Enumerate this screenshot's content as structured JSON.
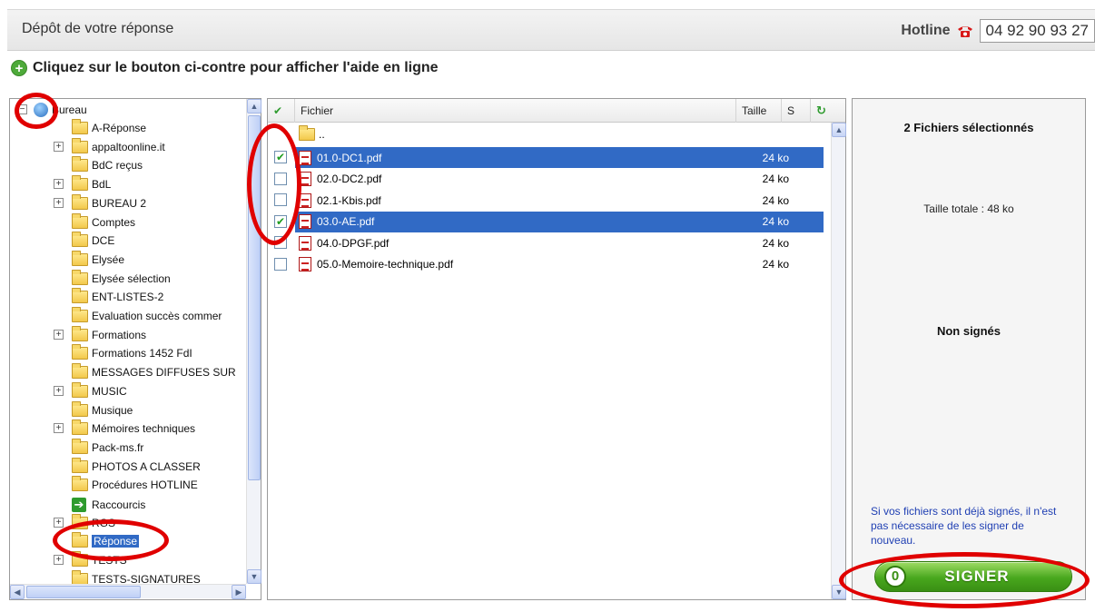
{
  "header": {
    "title": "Dépôt de votre réponse",
    "hotline_label": "Hotline",
    "hotline_number": "04 92 90 93 27"
  },
  "help": {
    "text": "Cliquez sur le bouton ci-contre pour afficher l'aide en ligne"
  },
  "tree": {
    "root": "Bureau",
    "items": [
      {
        "label": "A-Réponse",
        "expandable": false
      },
      {
        "label": "appaltoonline.it",
        "expandable": true
      },
      {
        "label": "BdC reçus",
        "expandable": false
      },
      {
        "label": "BdL",
        "expandable": true
      },
      {
        "label": "BUREAU 2",
        "expandable": true
      },
      {
        "label": "Comptes",
        "expandable": false
      },
      {
        "label": "DCE",
        "expandable": false
      },
      {
        "label": "Elysée",
        "expandable": false
      },
      {
        "label": "Elysée sélection",
        "expandable": false
      },
      {
        "label": "ENT-LISTES-2",
        "expandable": false
      },
      {
        "label": "Evaluation succès commer",
        "expandable": false
      },
      {
        "label": "Formations",
        "expandable": true
      },
      {
        "label": "Formations 1452 FdI",
        "expandable": false
      },
      {
        "label": "MESSAGES DIFFUSES SUR",
        "expandable": false
      },
      {
        "label": "MUSIC",
        "expandable": true
      },
      {
        "label": "Musique",
        "expandable": false
      },
      {
        "label": "Mémoires techniques",
        "expandable": true
      },
      {
        "label": "Pack-ms.fr",
        "expandable": false
      },
      {
        "label": "PHOTOS A CLASSER",
        "expandable": false
      },
      {
        "label": "Procédures HOTLINE",
        "expandable": false
      },
      {
        "label": "Raccourcis",
        "expandable": false,
        "shortcut": true
      },
      {
        "label": "RGS",
        "expandable": true
      },
      {
        "label": "Réponse",
        "expandable": false,
        "selected": true
      },
      {
        "label": "TESTS",
        "expandable": true
      },
      {
        "label": "TESTS-SIGNATURES",
        "expandable": false
      }
    ]
  },
  "files": {
    "columns": {
      "file": "Fichier",
      "size": "Taille",
      "signed": "S"
    },
    "parent": "..",
    "rows": [
      {
        "name": "01.0-DC1.pdf",
        "size": "24 ko",
        "checked": true
      },
      {
        "name": "02.0-DC2.pdf",
        "size": "24 ko",
        "checked": false
      },
      {
        "name": "02.1-Kbis.pdf",
        "size": "24 ko",
        "checked": false
      },
      {
        "name": "03.0-AE.pdf",
        "size": "24 ko",
        "checked": true
      },
      {
        "name": "04.0-DPGF.pdf",
        "size": "24 ko",
        "checked": false
      },
      {
        "name": "05.0-Memoire-technique.pdf",
        "size": "24 ko",
        "checked": false
      }
    ]
  },
  "summary": {
    "selected": "2 Fichiers sélectionnés",
    "total_size": "Taille totale : 48 ko",
    "status": "Non signés",
    "note": "Si vos fichiers sont déjà signés, il n'est pas nécessaire de les signer de nouveau.",
    "sign_count": "0",
    "sign_label": "SIGNER"
  },
  "colors": {
    "selection": "#316ac5",
    "sign_button": "#48a71d",
    "annotation": "#e00000",
    "note_text": "#1f3fb3"
  }
}
